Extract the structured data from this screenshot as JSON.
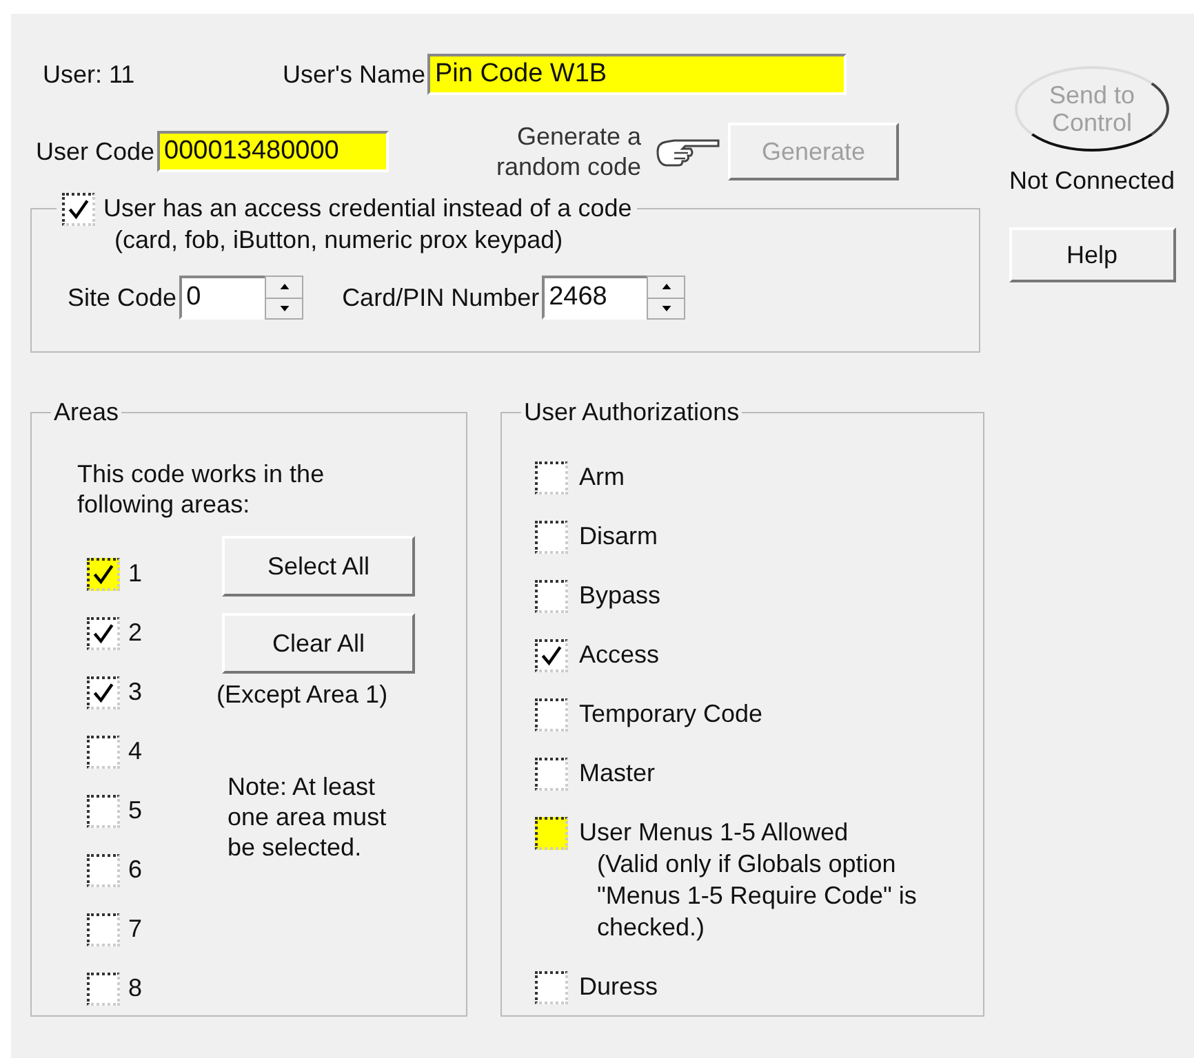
{
  "user_label": "User: 11",
  "name_field": {
    "label": "User's Name",
    "value": "Pin Code W1B",
    "highlighted": true
  },
  "code_field": {
    "label": "User Code",
    "value": "000013480000",
    "highlighted": true
  },
  "generate": {
    "hint": "Generate a random code",
    "button": "Generate",
    "disabled": true
  },
  "send_button": {
    "label": "Send to Control",
    "disabled": true
  },
  "connection_status": "Not Connected",
  "help_button": "Help",
  "credential": {
    "label": "User has an access credential instead of a code",
    "checked": true,
    "note": "(card, fob, iButton, numeric prox keypad)",
    "site_code": {
      "label": "Site Code",
      "value": "0"
    },
    "card_number": {
      "label": "Card/PIN Number",
      "value": "2468"
    }
  },
  "areas": {
    "title": "Areas",
    "intro": "This code works in the following areas:",
    "select_all": "Select All",
    "clear_all": "Clear All",
    "clear_note": "(Except Area 1)",
    "note": "Note: At least one area must be selected.",
    "items": [
      {
        "label": "1",
        "checked": true,
        "color": "#ffff00"
      },
      {
        "label": "2",
        "checked": true,
        "color": "#ffffff"
      },
      {
        "label": "3",
        "checked": true,
        "color": "#ffffff"
      },
      {
        "label": "4",
        "checked": false,
        "color": "#ffffff"
      },
      {
        "label": "5",
        "checked": false,
        "color": "#ffffff"
      },
      {
        "label": "6",
        "checked": false,
        "color": "#ffffff"
      },
      {
        "label": "7",
        "checked": false,
        "color": "#ffffff"
      },
      {
        "label": "8",
        "checked": false,
        "color": "#ffffff"
      }
    ]
  },
  "authorizations": {
    "title": "User Authorizations",
    "items": [
      {
        "label": "Arm",
        "checked": false,
        "color": "#ffffff"
      },
      {
        "label": "Disarm",
        "checked": false,
        "color": "#ffffff"
      },
      {
        "label": "Bypass",
        "checked": false,
        "color": "#ffffff"
      },
      {
        "label": "Access",
        "checked": true,
        "color": "#ffffff"
      },
      {
        "label": "Temporary Code",
        "checked": false,
        "color": "#ffffff"
      },
      {
        "label": "Master",
        "checked": false,
        "color": "#ffffff"
      },
      {
        "label": "User Menus 1-5 Allowed",
        "checked": false,
        "color": "#ffff00",
        "note": "(Valid only if Globals option \"Menus 1-5 Require Code\" is checked.)"
      },
      {
        "label": "Duress",
        "checked": false,
        "color": "#ffffff"
      }
    ]
  }
}
